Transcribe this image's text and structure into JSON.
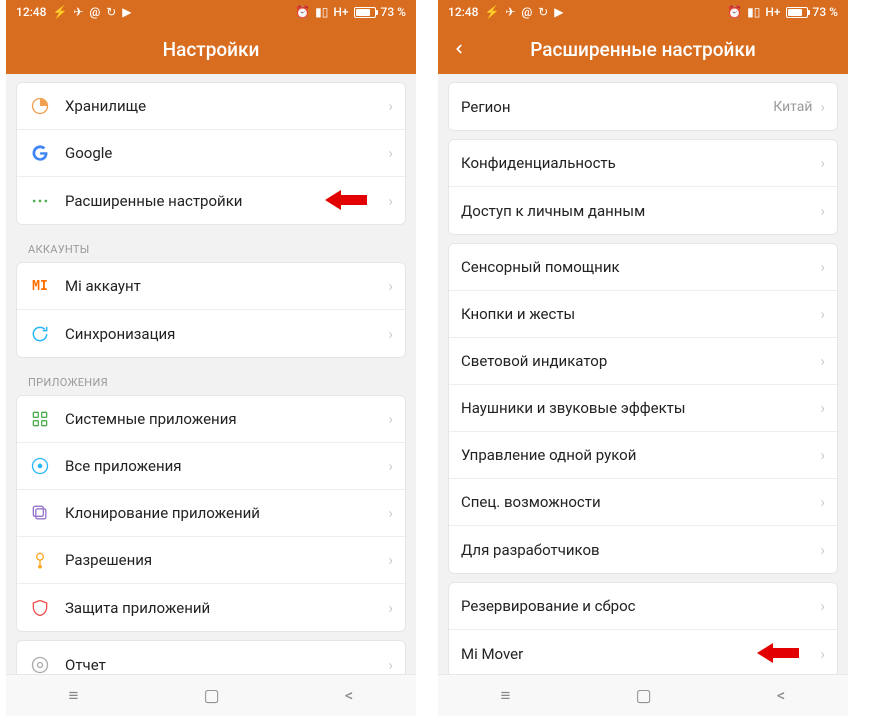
{
  "status": {
    "time": "12:48",
    "network": "H+",
    "battery": "73 %"
  },
  "left": {
    "title": "Настройки",
    "groups": [
      {
        "header": null,
        "items": [
          {
            "icon": "storage",
            "label": "Хранилище"
          },
          {
            "icon": "google",
            "label": "Google"
          },
          {
            "icon": "more",
            "label": "Расширенные настройки",
            "arrow": true
          }
        ]
      },
      {
        "header": "АККАУНТЫ",
        "items": [
          {
            "icon": "mi",
            "label": "Mi аккаунт"
          },
          {
            "icon": "sync",
            "label": "Синхронизация"
          }
        ]
      },
      {
        "header": "ПРИЛОЖЕНИЯ",
        "items": [
          {
            "icon": "apps",
            "label": "Системные приложения"
          },
          {
            "icon": "allapps",
            "label": "Все приложения"
          },
          {
            "icon": "clone",
            "label": "Клонирование приложений"
          },
          {
            "icon": "perm",
            "label": "Разрешения"
          },
          {
            "icon": "shield",
            "label": "Защита приложений"
          }
        ]
      },
      {
        "header": null,
        "items": [
          {
            "icon": "report",
            "label": "Отчет"
          }
        ]
      }
    ]
  },
  "right": {
    "title": "Расширенные настройки",
    "groups": [
      {
        "items": [
          {
            "label": "Регион",
            "value": "Китай"
          }
        ]
      },
      {
        "items": [
          {
            "label": "Конфиденциальность"
          },
          {
            "label": "Доступ к личным данным"
          }
        ]
      },
      {
        "items": [
          {
            "label": "Сенсорный помощник"
          },
          {
            "label": "Кнопки и жесты"
          },
          {
            "label": "Световой индикатор"
          },
          {
            "label": "Наушники и звуковые эффекты"
          },
          {
            "label": "Управление одной рукой"
          },
          {
            "label": "Спец. возможности"
          },
          {
            "label": "Для разработчиков"
          }
        ]
      },
      {
        "items": [
          {
            "label": "Резервирование и сброс"
          },
          {
            "label": "Mi Mover",
            "arrow": true
          }
        ]
      }
    ]
  }
}
